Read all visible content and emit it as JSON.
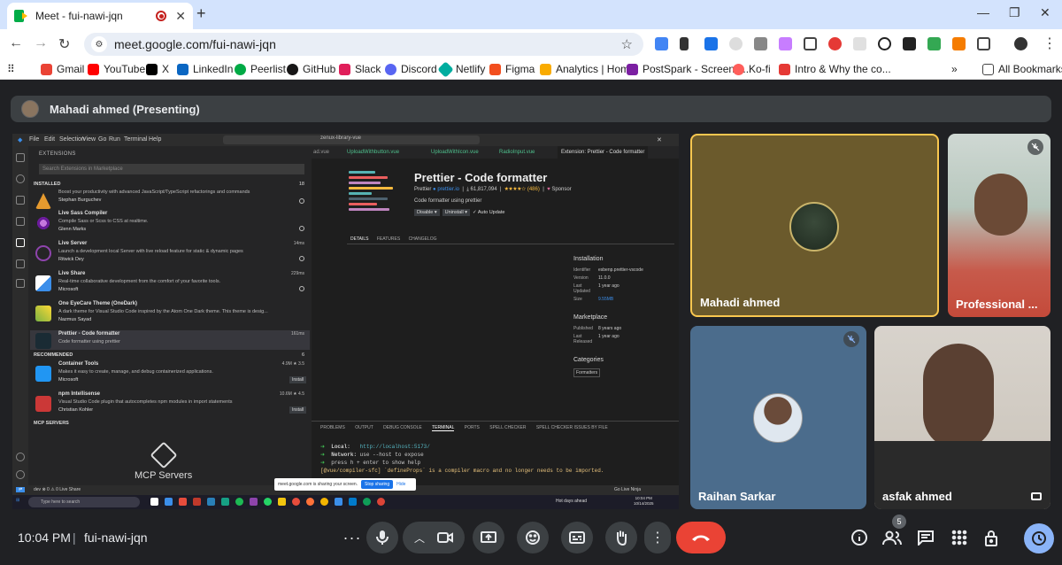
{
  "browser": {
    "tab_title": "Meet - fui-nawi-jqn",
    "url": "meet.google.com/fui-nawi-jqn",
    "new_tab": "+",
    "minimize": "—",
    "restore": "❐",
    "close": "✕",
    "tab_close": "✕",
    "bookmarks": [
      {
        "label": "Gmail",
        "color": "#ea4335"
      },
      {
        "label": "YouTube",
        "color": "#ff0000"
      },
      {
        "label": "X",
        "color": "#000000"
      },
      {
        "label": "LinkedIn",
        "color": "#0a66c2"
      },
      {
        "label": "Peerlist",
        "color": "#00aa45"
      },
      {
        "label": "GitHub",
        "color": "#181717"
      },
      {
        "label": "Slack",
        "color": "#e01e5a"
      },
      {
        "label": "Discord",
        "color": "#5865f2"
      },
      {
        "label": "Netlify",
        "color": "#00ad9f"
      },
      {
        "label": "Figma",
        "color": "#f24e1e"
      },
      {
        "label": "Analytics | Home",
        "color": "#f9ab00"
      },
      {
        "label": "PostSpark - Screens...",
        "color": "#7b1fa2"
      },
      {
        "label": "Ko-fi",
        "color": "#ff5e5b"
      },
      {
        "label": "Intro & Why the co...",
        "color": "#e53935"
      }
    ],
    "more_bookmarks": "»",
    "all_bookmarks": "All Bookmarks"
  },
  "meet": {
    "presenter_label": "Mahadi ahmed (Presenting)",
    "time": "10:04 PM",
    "separator": "|",
    "meeting_code": "fui-nawi-jqn",
    "participants_count": "5",
    "participants": [
      {
        "name": "Mahadi ahmed"
      },
      {
        "name": "Professional ..."
      },
      {
        "name": "Raihan Sarkar"
      },
      {
        "name": "asfak ahmed"
      }
    ],
    "colors": {
      "leave": "#ea4335",
      "active_border": "#f9c74f",
      "activity": "#8ab4f8"
    }
  },
  "shared_screen": {
    "menu": [
      "File",
      "Edit",
      "Selection",
      "View",
      "Go",
      "Run",
      "Terminal",
      "Help"
    ],
    "search": "zenux-library-vue",
    "sidebar_header": "EXTENSIONS",
    "search_placeholder": "Search Extensions in Marketplace",
    "installed_label": "INSTALLED",
    "installed_count": "18",
    "recommended_label": "RECOMMENDED",
    "recommended_count": "6",
    "mcp_label": "MCP SERVERS",
    "mcp_title": "MCP Servers",
    "extensions": [
      {
        "name": "",
        "desc": "Boost your productivity with advanced JavaScript/TypeScript refactorings and commands",
        "author": "Stephan Burguchev",
        "meta": ""
      },
      {
        "name": "Live Sass Compiler",
        "desc": "Compile Sass or Scss to CSS at realtime.",
        "author": "Glenn Marks",
        "meta": ""
      },
      {
        "name": "Live Server",
        "desc": "Launch a development local Server with live reload feature for static & dynamic pages",
        "author": "Ritwick Dey",
        "meta": "14ms"
      },
      {
        "name": "Live Share",
        "desc": "Real-time collaborative development from the comfort of your favorite tools.",
        "author": "Microsoft",
        "meta": "229ms"
      },
      {
        "name": "One EyeCare Theme (OneDark)",
        "desc": "A dark theme for Visual Studio Code inspired by the Atom One Dark theme. This theme is desig...",
        "author": "Nazmus Sayad",
        "meta": ""
      },
      {
        "name": "Prettier - Code formatter",
        "desc": "Code formatter using prettier",
        "author": "",
        "meta": "161ms"
      }
    ],
    "recommended": [
      {
        "name": "Container Tools",
        "desc": "Makes it easy to create, manage, and debug containerized applications.",
        "author": "Microsoft",
        "meta": "4.9M  ★ 3.5",
        "install": "Install"
      },
      {
        "name": "npm Intellisense",
        "desc": "Visual Studio Code plugin that autocompletes npm modules in import statements",
        "author": "Christian Kohler",
        "meta": "10.6M  ★ 4.5",
        "install": "Install"
      }
    ],
    "editor_tabs": [
      "ad.vue",
      "UploadWithbutton.vue",
      "UploadWithIcon.vue",
      "RadioInput.vue",
      "Extension: Prettier - Code formatter"
    ],
    "prettier": {
      "title": "Prettier - Code formatter",
      "publisher": "Prettier",
      "domain": "prettier.io",
      "installs": "61,817,094",
      "rating": "★★★★☆ (486)",
      "sponsor": "Sponsor",
      "desc": "Code formatter using prettier",
      "disable": "Disable ▾",
      "uninstall": "Uninstall ▾",
      "auto_update": "✓ Auto Update"
    },
    "detail_tabs": [
      "DETAILS",
      "FEATURES",
      "CHANGELOG"
    ],
    "installation": {
      "title": "Installation",
      "identifier_label": "Identifier",
      "identifier": "esbenp.prettier-vscode",
      "version_label": "Version",
      "version": "11.0.0",
      "updated_label": "Last Updated",
      "updated": "1 year ago",
      "size_label": "Size",
      "size": "9.55MB"
    },
    "marketplace": {
      "title": "Marketplace",
      "published_label": "Published",
      "published": "8 years ago",
      "released_label": "Last Released",
      "released": "1 year ago"
    },
    "categories": {
      "title": "Categories",
      "item": "Formatters"
    },
    "panel_tabs": [
      "PROBLEMS",
      "OUTPUT",
      "DEBUG CONSOLE",
      "TERMINAL",
      "PORTS",
      "SPELL CHECKER",
      "SPELL CHECKER ISSUES BY FILE"
    ],
    "terminal": {
      "local_label": "Local:",
      "local_url": "http://localhost:5173/",
      "network_label": "Network:",
      "network_text": "use --host to expose",
      "press_text": "press h + enter to show help",
      "warn_tag": "[@vue/compiler-sfc]",
      "warn_text": "`defineProps` is a compiler macro and no longer needs to be imported."
    },
    "status_left": "dev  ⊗ 0 ⚠ 0   Live Share",
    "status_right": "Go Live   Ninja",
    "share_bar": {
      "text": "meet.google.com is sharing your screen.",
      "stop": "Stop sharing",
      "hide": "Hide"
    },
    "taskbar": {
      "search": "Type here to search",
      "weather": "Hot days ahead",
      "time": "10:04 PM",
      "date": "10/14/2025"
    }
  }
}
